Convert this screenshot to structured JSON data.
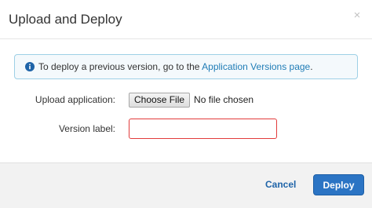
{
  "dialog": {
    "title": "Upload and Deploy",
    "close_glyph": "×"
  },
  "info": {
    "icon": "info-circle-icon",
    "text_before": "To deploy a previous version, go to the ",
    "link_text": "Application Versions page",
    "text_after": "."
  },
  "form": {
    "upload_label": "Upload application:",
    "choose_file_label": "Choose File",
    "file_status": "No file chosen",
    "version_label": "Version label:",
    "version_value": ""
  },
  "footer": {
    "cancel_label": "Cancel",
    "deploy_label": "Deploy"
  },
  "colors": {
    "accent": "#2b74c4",
    "link": "#1f7cb6",
    "error_border": "#e23b3b",
    "info_border": "#9ed0e6"
  }
}
